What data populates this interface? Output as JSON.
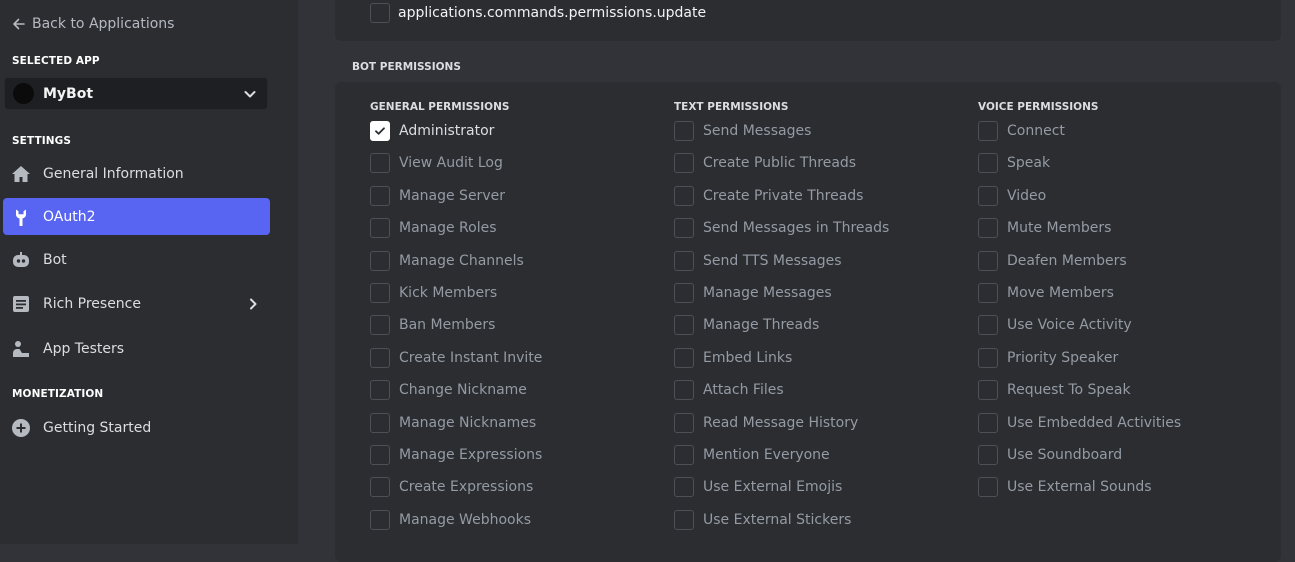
{
  "sidebar": {
    "back_label": "Back to Applications",
    "selected_app_label": "SELECTED APP",
    "app_name": "MyBot",
    "settings_label": "SETTINGS",
    "items": [
      {
        "label": "General Information",
        "icon": "home-icon"
      },
      {
        "label": "OAuth2",
        "icon": "wrench-icon",
        "active": true
      },
      {
        "label": "Bot",
        "icon": "bot-icon"
      },
      {
        "label": "Rich Presence",
        "icon": "document-icon",
        "has_chevron": true
      },
      {
        "label": "App Testers",
        "icon": "person-icon"
      }
    ],
    "monetization_label": "MONETIZATION",
    "monetization_items": [
      {
        "label": "Getting Started",
        "icon": "plus-circle-icon"
      }
    ]
  },
  "scopes": {
    "visible_scope": "applications.commands.permissions.update"
  },
  "bot_permissions": {
    "title": "BOT PERMISSIONS",
    "general": {
      "title": "GENERAL PERMISSIONS",
      "items": [
        "Administrator",
        "View Audit Log",
        "Manage Server",
        "Manage Roles",
        "Manage Channels",
        "Kick Members",
        "Ban Members",
        "Create Instant Invite",
        "Change Nickname",
        "Manage Nicknames",
        "Manage Expressions",
        "Create Expressions",
        "Manage Webhooks"
      ],
      "checked": [
        true,
        false,
        false,
        false,
        false,
        false,
        false,
        false,
        false,
        false,
        false,
        false,
        false
      ]
    },
    "text": {
      "title": "TEXT PERMISSIONS",
      "items": [
        "Send Messages",
        "Create Public Threads",
        "Create Private Threads",
        "Send Messages in Threads",
        "Send TTS Messages",
        "Manage Messages",
        "Manage Threads",
        "Embed Links",
        "Attach Files",
        "Read Message History",
        "Mention Everyone",
        "Use External Emojis",
        "Use External Stickers"
      ]
    },
    "voice": {
      "title": "VOICE PERMISSIONS",
      "items": [
        "Connect",
        "Speak",
        "Video",
        "Mute Members",
        "Deafen Members",
        "Move Members",
        "Use Voice Activity",
        "Priority Speaker",
        "Request To Speak",
        "Use Embedded Activities",
        "Use Soundboard",
        "Use External Sounds"
      ]
    }
  },
  "colors": {
    "accent": "#5865f2",
    "sidebar_bg": "#2b2d31",
    "main_bg": "#313338",
    "checkbox_checked": "#ffffff"
  }
}
